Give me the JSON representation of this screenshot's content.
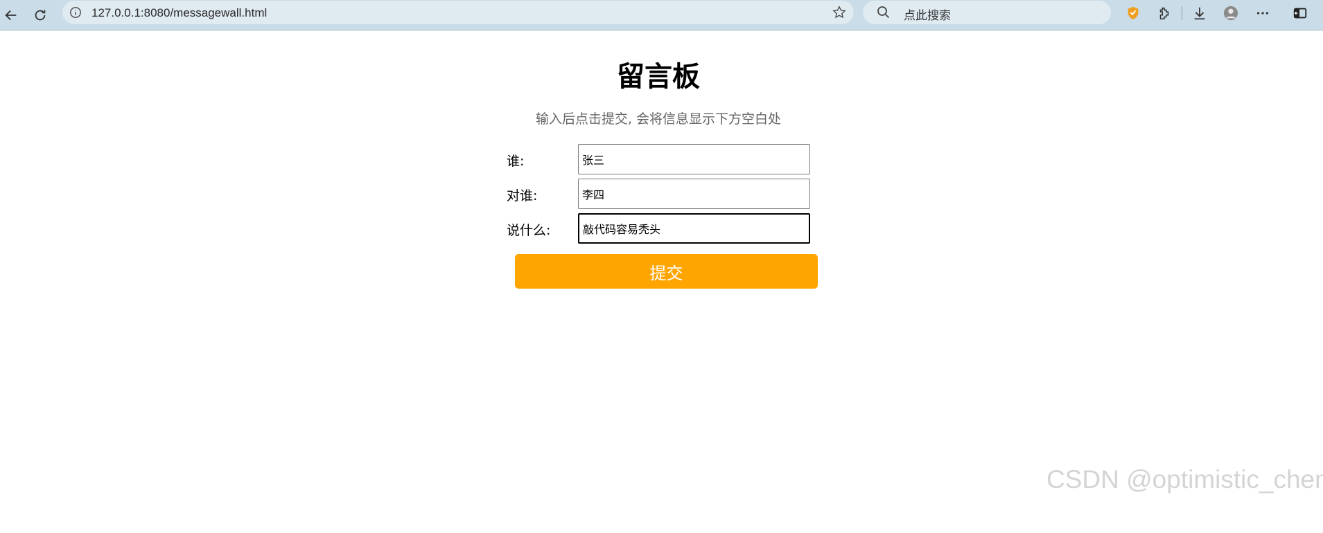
{
  "browser": {
    "url": "127.0.0.1:8080/messagewall.html",
    "search_placeholder": "点此搜索",
    "accent": "#c9dce8"
  },
  "page": {
    "title": "留言板",
    "subtitle": "输入后点击提交, 会将信息显示下方空白处",
    "form": {
      "from_label": "谁:",
      "from_value": "张三",
      "to_label": "对谁:",
      "to_value": "李四",
      "message_label": "说什么:",
      "message_value": "敲代码容易秃头"
    },
    "submit_label": "提交",
    "submit_color": "#ffa500"
  },
  "watermark": "CSDN @optimistic_chen"
}
